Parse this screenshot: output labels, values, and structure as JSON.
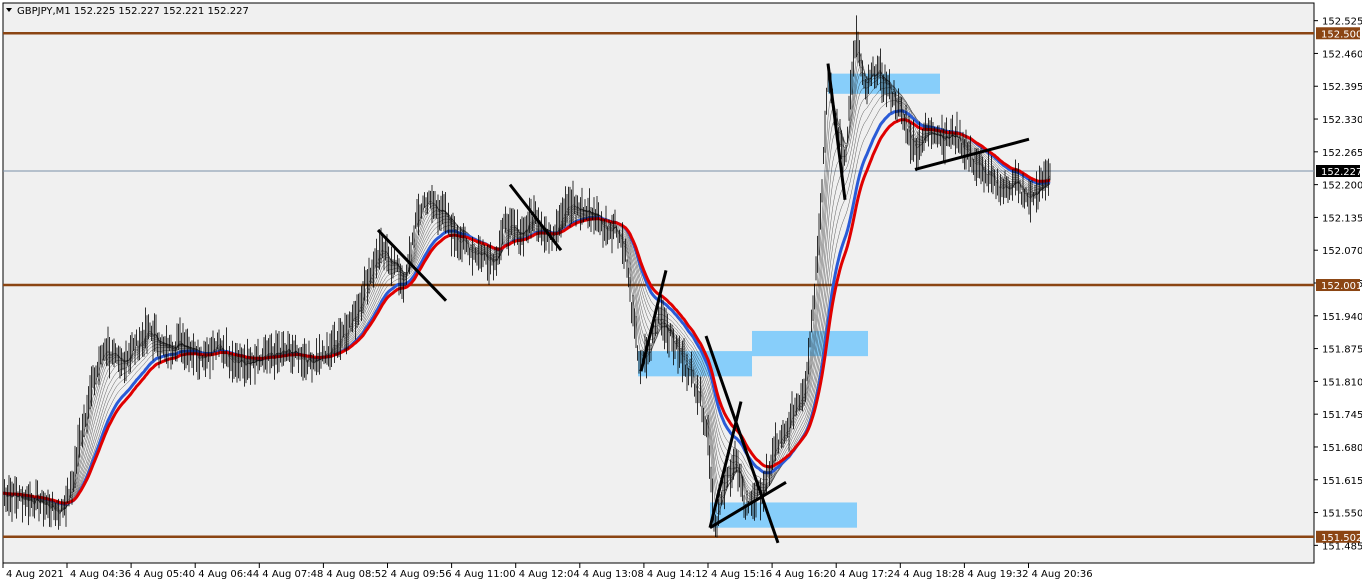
{
  "window": {
    "symbol_header": "GBPJPY,M1  152.225 152.227 152.221 152.227",
    "menu_icon": "triangle-down-icon"
  },
  "chart_data": {
    "type": "line",
    "y_range": [
      151.45,
      152.56
    ],
    "y_ticks": [
      "152.525",
      "152.460",
      "152.395",
      "152.330",
      "152.265",
      "152.200",
      "152.135",
      "152.070",
      "152.005",
      "151.940",
      "151.875",
      "151.810",
      "151.745",
      "151.680",
      "151.615",
      "151.550",
      "151.485"
    ],
    "x_ticks": [
      "4 Aug 2021",
      "4 Aug 04:36",
      "4 Aug 05:40",
      "4 Aug 06:44",
      "4 Aug 07:48",
      "4 Aug 08:52",
      "4 Aug 09:56",
      "4 Aug 11:00",
      "4 Aug 12:04",
      "4 Aug 13:08",
      "4 Aug 14:12",
      "4 Aug 15:16",
      "4 Aug 16:20",
      "4 Aug 17:24",
      "4 Aug 18:28",
      "4 Aug 19:32",
      "4 Aug 20:36"
    ],
    "horizontal_levels": [
      {
        "value": 152.5,
        "label": "152.500",
        "color": "#8b4513"
      },
      {
        "value": 152.001,
        "label": "152.001",
        "color": "#8b4513"
      },
      {
        "value": 151.502,
        "label": "151.502",
        "color": "#8b4513"
      }
    ],
    "current_price": {
      "value": 152.227,
      "label": "152.227"
    },
    "price_path": [
      [
        0,
        151.59
      ],
      [
        20,
        151.58
      ],
      [
        40,
        151.57
      ],
      [
        60,
        151.55
      ],
      [
        72,
        151.6
      ],
      [
        80,
        151.7
      ],
      [
        92,
        151.8
      ],
      [
        105,
        151.88
      ],
      [
        120,
        151.84
      ],
      [
        135,
        151.88
      ],
      [
        150,
        151.91
      ],
      [
        165,
        151.87
      ],
      [
        180,
        151.89
      ],
      [
        200,
        151.86
      ],
      [
        220,
        151.88
      ],
      [
        235,
        151.85
      ],
      [
        250,
        151.84
      ],
      [
        270,
        151.86
      ],
      [
        290,
        151.87
      ],
      [
        310,
        151.85
      ],
      [
        325,
        151.86
      ],
      [
        340,
        151.9
      ],
      [
        355,
        151.94
      ],
      [
        365,
        152.0
      ],
      [
        380,
        152.07
      ],
      [
        395,
        152.04
      ],
      [
        405,
        152.0
      ],
      [
        415,
        152.12
      ],
      [
        425,
        152.17
      ],
      [
        440,
        152.15
      ],
      [
        455,
        152.1
      ],
      [
        470,
        152.07
      ],
      [
        485,
        152.06
      ],
      [
        495,
        152.05
      ],
      [
        505,
        152.12
      ],
      [
        520,
        152.1
      ],
      [
        535,
        152.14
      ],
      [
        550,
        152.09
      ],
      [
        565,
        152.16
      ],
      [
        580,
        152.15
      ],
      [
        595,
        152.14
      ],
      [
        605,
        152.11
      ],
      [
        615,
        152.12
      ],
      [
        625,
        152.07
      ],
      [
        632,
        151.95
      ],
      [
        640,
        151.84
      ],
      [
        650,
        151.87
      ],
      [
        660,
        151.95
      ],
      [
        670,
        151.9
      ],
      [
        680,
        151.86
      ],
      [
        690,
        151.83
      ],
      [
        700,
        151.78
      ],
      [
        708,
        151.7
      ],
      [
        715,
        151.52
      ],
      [
        725,
        151.6
      ],
      [
        735,
        151.66
      ],
      [
        745,
        151.56
      ],
      [
        755,
        151.58
      ],
      [
        765,
        151.6
      ],
      [
        775,
        151.68
      ],
      [
        785,
        151.7
      ],
      [
        795,
        151.76
      ],
      [
        805,
        151.8
      ],
      [
        815,
        152.0
      ],
      [
        822,
        152.2
      ],
      [
        828,
        152.42
      ],
      [
        835,
        152.33
      ],
      [
        845,
        152.25
      ],
      [
        852,
        152.42
      ],
      [
        857,
        152.49
      ],
      [
        865,
        152.38
      ],
      [
        875,
        152.43
      ],
      [
        885,
        152.4
      ],
      [
        895,
        152.37
      ],
      [
        905,
        152.32
      ],
      [
        915,
        152.27
      ],
      [
        925,
        152.3
      ],
      [
        935,
        152.31
      ],
      [
        945,
        152.29
      ],
      [
        955,
        152.3
      ],
      [
        965,
        152.27
      ],
      [
        975,
        152.24
      ],
      [
        985,
        152.22
      ],
      [
        995,
        152.2
      ],
      [
        1005,
        152.19
      ],
      [
        1015,
        152.21
      ],
      [
        1025,
        152.17
      ],
      [
        1035,
        152.18
      ],
      [
        1045,
        152.21
      ],
      [
        1050,
        152.227
      ]
    ],
    "zones": [
      {
        "x0": 828,
        "x1": 940,
        "y0": 152.38,
        "y1": 152.42
      },
      {
        "x0": 752,
        "x1": 868,
        "y0": 151.86,
        "y1": 151.91
      },
      {
        "x0": 638,
        "x1": 752,
        "y0": 151.82,
        "y1": 151.87
      },
      {
        "x0": 710,
        "x1": 857,
        "y0": 151.52,
        "y1": 151.57
      }
    ],
    "trendlines": [
      {
        "x0": 378,
        "y0": 152.11,
        "x1": 446,
        "y1": 151.97
      },
      {
        "x0": 510,
        "y0": 152.2,
        "x1": 561,
        "y1": 152.07
      },
      {
        "x0": 641,
        "y0": 151.83,
        "x1": 666,
        "y1": 152.03
      },
      {
        "x0": 706,
        "y0": 151.9,
        "x1": 778,
        "y1": 151.49
      },
      {
        "x0": 710,
        "y0": 151.52,
        "x1": 741,
        "y1": 151.77
      },
      {
        "x0": 710,
        "y0": 151.52,
        "x1": 786,
        "y1": 151.61
      },
      {
        "x0": 828,
        "y0": 152.44,
        "x1": 845,
        "y1": 152.17
      },
      {
        "x0": 915,
        "y0": 152.23,
        "x1": 1029,
        "y1": 152.29
      }
    ],
    "ribbon_ma_colors": {
      "slow": "#e00000",
      "mid": "#2a5bd7",
      "fast": "#222222"
    },
    "grid": false
  }
}
